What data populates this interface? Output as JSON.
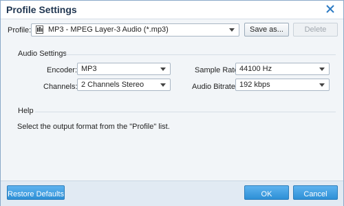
{
  "window": {
    "title": "Profile Settings"
  },
  "profile": {
    "label": "Profile:",
    "selected": "MP3 - MPEG Layer-3 Audio (*.mp3)",
    "save_as": "Save as...",
    "delete": "Delete"
  },
  "audio": {
    "section": "Audio Settings",
    "encoder_label": "Encoder:",
    "encoder_value": "MP3",
    "channels_label": "Channels:",
    "channels_value": "2 Channels Stereo",
    "sample_rate_label": "Sample Rate:",
    "sample_rate_value": "44100 Hz",
    "bitrate_label": "Audio Bitrate:",
    "bitrate_value": "192 kbps"
  },
  "help": {
    "section": "Help",
    "text": "Select the output format from the \"Profile\" list."
  },
  "footer": {
    "restore": "Restore Defaults",
    "ok": "OK",
    "cancel": "Cancel"
  }
}
